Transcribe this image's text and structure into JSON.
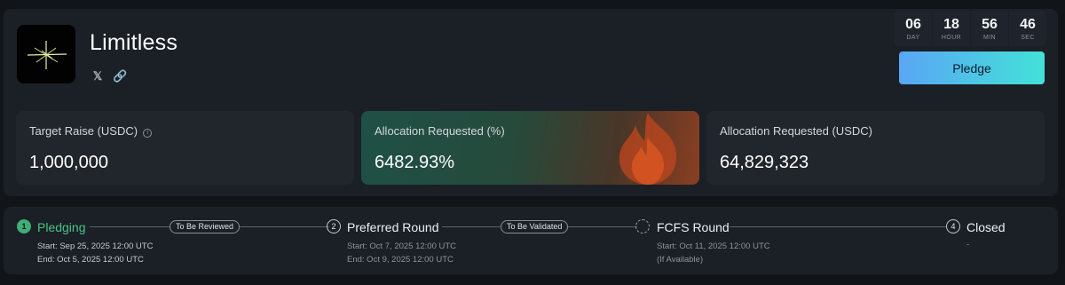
{
  "project": {
    "name": "Limitless",
    "logo_icon": "sparkle-logo",
    "social_x": "𝕏",
    "social_link": "🔗"
  },
  "countdown": [
    {
      "value": "06",
      "label": "DAY"
    },
    {
      "value": "18",
      "label": "HOUR"
    },
    {
      "value": "56",
      "label": "MIN"
    },
    {
      "value": "46",
      "label": "SEC"
    }
  ],
  "pledge_button": "Pledge",
  "stats": [
    {
      "label": "Target Raise (USDC)",
      "value": "1,000,000",
      "info": "i"
    },
    {
      "label": "Allocation Requested (%)",
      "value": "6482.93%"
    },
    {
      "label": "Allocation Requested (USDC)",
      "value": "64,829,323"
    }
  ],
  "timeline": {
    "steps": [
      {
        "number": "1",
        "title": "Pledging",
        "line1": "Start: Sep 25, 2025 12:00 UTC",
        "line2": "End: Oct 5, 2025 12:00 UTC"
      },
      {
        "number": "2",
        "title": "Preferred Round",
        "line1": "Start: Oct 7, 2025 12:00 UTC",
        "line2": "End: Oct 9, 2025 12:00 UTC"
      },
      {
        "number": "",
        "title": "FCFS Round",
        "line1": "Start: Oct 11, 2025 12:00 UTC",
        "line2": "(If Available)"
      },
      {
        "number": "4",
        "title": "Closed",
        "line1": "-"
      }
    ],
    "badges": [
      "To Be Reviewed",
      "To Be Validated"
    ]
  },
  "colors": {
    "background": "#111418",
    "panel": "#1b1f26",
    "accent_green": "#48c486",
    "pledge_gradient_start": "#5aa6f5",
    "pledge_gradient_end": "#42e2d8"
  }
}
